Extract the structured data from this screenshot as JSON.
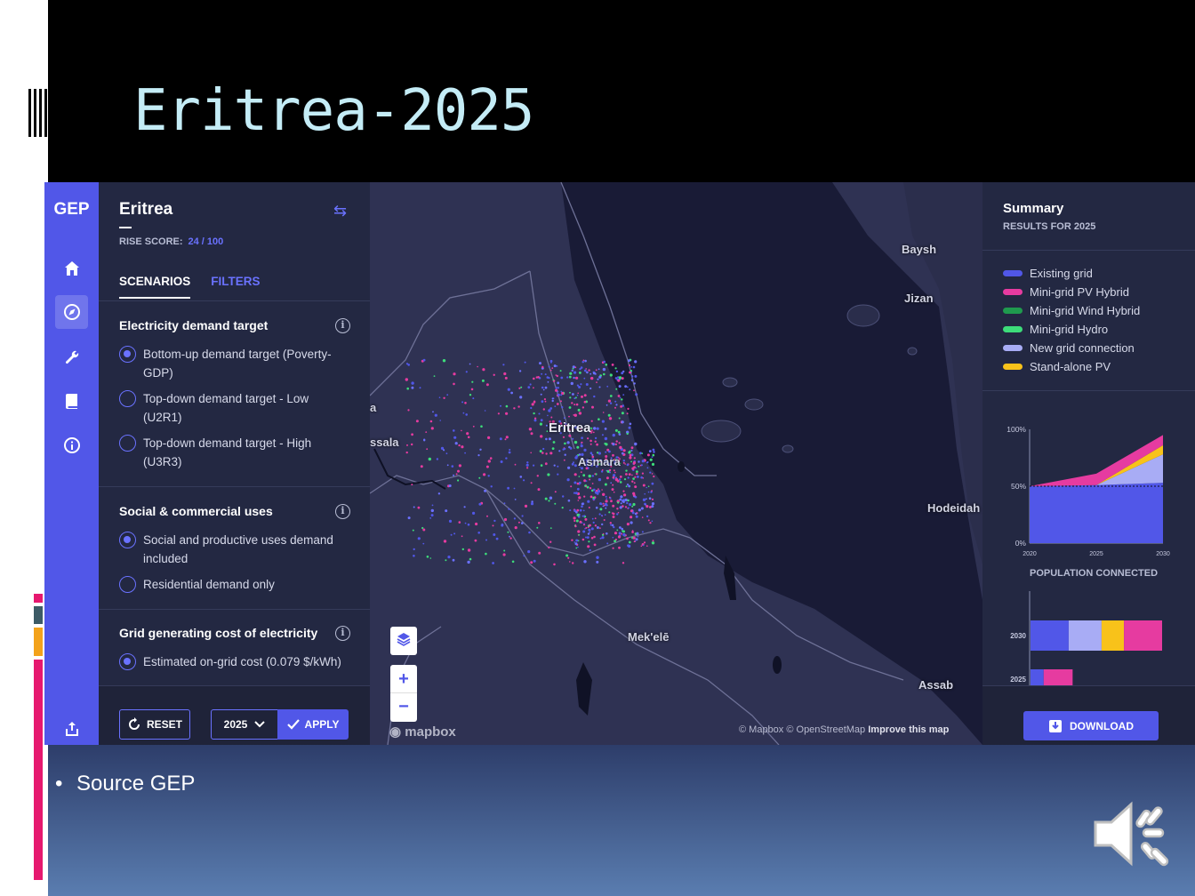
{
  "slide": {
    "title": "Eritrea-2025",
    "bullet": "Source GEP"
  },
  "app": {
    "logo": "GEP",
    "rail_icons": [
      "home-icon",
      "compass-icon",
      "wrench-icon",
      "book-icon",
      "info-icon",
      "share-icon"
    ],
    "country": "Eritrea",
    "rise_label": "RISE SCORE:",
    "rise_value": "24 / 100",
    "tabs": {
      "scenarios": "SCENARIOS",
      "filters": "FILTERS"
    },
    "sections": [
      {
        "title": "Electricity demand target",
        "options": [
          {
            "label": "Bottom-up demand target (Poverty-GDP)",
            "selected": true
          },
          {
            "label": "Top-down demand target - Low (U2R1)",
            "selected": false
          },
          {
            "label": "Top-down demand target - High (U3R3)",
            "selected": false
          }
        ]
      },
      {
        "title": "Social & commercial uses",
        "options": [
          {
            "label": "Social and productive uses demand included",
            "selected": true
          },
          {
            "label": "Residential demand only",
            "selected": false
          }
        ]
      },
      {
        "title": "Grid generating cost of electricity",
        "options": [
          {
            "label": "Estimated on-grid cost (0.079 $/kWh)",
            "selected": true
          }
        ]
      }
    ],
    "footer": {
      "reset": "RESET",
      "year": "2025",
      "apply": "APPLY"
    }
  },
  "map": {
    "labels": {
      "baysh": "Baysh",
      "jizan": "Jizan",
      "eritrea": "Eritrea",
      "asmara": "Asmara",
      "hodeidah": "Hodeidah",
      "mekele": "Mek'elē",
      "assab": "Assab",
      "kassala_partial": "ssala",
      "a_partial": "a"
    },
    "controls": {
      "zoom_in": "+",
      "zoom_out": "−"
    },
    "mapbox": "mapbox",
    "attribution": "© Mapbox © OpenStreetMap",
    "improve": "Improve this map"
  },
  "summary": {
    "title": "Summary",
    "subtitle": "RESULTS FOR 2025",
    "legend": [
      {
        "label": "Existing grid",
        "color": "#5157e8"
      },
      {
        "label": "Mini-grid PV Hybrid",
        "color": "#e63ba0"
      },
      {
        "label": "Mini-grid Wind Hybrid",
        "color": "#1f9a4e"
      },
      {
        "label": "Mini-grid Hydro",
        "color": "#3ddc7a"
      },
      {
        "label": "New grid connection",
        "color": "#a8acf5"
      },
      {
        "label": "Stand-alone PV",
        "color": "#f8c21a"
      }
    ],
    "population_title": "POPULATION CONNECTED",
    "download": "DOWNLOAD"
  },
  "chart_data": [
    {
      "type": "area",
      "x": [
        2020,
        2025,
        2030
      ],
      "x_tick_labels": [
        "2020",
        "2025",
        "2030"
      ],
      "y_tick_labels": [
        "0%",
        "50%",
        "100%"
      ],
      "ylim": [
        0,
        100
      ],
      "series": [
        {
          "name": "Existing grid",
          "values": [
            50,
            51,
            53
          ]
        },
        {
          "name": "New grid connection",
          "values": [
            0,
            0,
            25
          ]
        },
        {
          "name": "Stand-alone PV",
          "values": [
            0,
            0,
            8
          ]
        },
        {
          "name": "Mini-grid PV Hybrid",
          "values": [
            0,
            10,
            9
          ]
        }
      ]
    },
    {
      "type": "bar",
      "orientation": "horizontal-stacked",
      "title": "POPULATION CONNECTED",
      "categories": [
        "2030",
        "2025"
      ],
      "series": [
        {
          "name": "Existing grid",
          "values": [
            29,
            10
          ]
        },
        {
          "name": "New grid connection",
          "values": [
            25,
            0
          ]
        },
        {
          "name": "Stand-alone PV",
          "values": [
            17,
            0
          ]
        },
        {
          "name": "Mini-grid PV Hybrid",
          "values": [
            29,
            22
          ]
        }
      ]
    }
  ]
}
